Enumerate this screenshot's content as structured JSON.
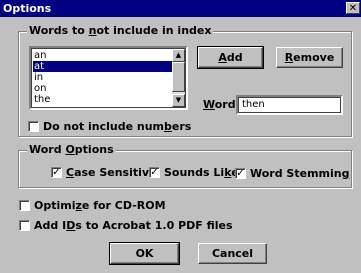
{
  "window": {
    "title": "Options",
    "close_glyph": "✕"
  },
  "index_group": {
    "title_pre": "Words to ",
    "title_accel": "n",
    "title_post": "ot include in index",
    "words": [
      "an",
      "at",
      "in",
      "on",
      "the"
    ],
    "selected_index": 1,
    "add_accel": "A",
    "add_rest": "dd",
    "remove_accel": "R",
    "remove_rest": "emove",
    "word_label_accel": "W",
    "word_label_rest": "ord:",
    "word_value": "then",
    "no_numbers_pre": "Do not include num",
    "no_numbers_accel": "b",
    "no_numbers_post": "ers",
    "no_numbers_checked": false
  },
  "word_options": {
    "title_pre": "Word ",
    "title_accel": "O",
    "title_post": "ptions",
    "case_sensitive": {
      "accel": "C",
      "rest": "ase Sensitive",
      "checked": true
    },
    "sounds_like": {
      "pre": "Sounds Li",
      "accel": "k",
      "post": "e",
      "checked": true
    },
    "word_stemming": {
      "pre": "Word Stemmin",
      "accel": "g",
      "checked": true
    }
  },
  "optimize_cd": {
    "pre": "Optimi",
    "accel": "z",
    "post": "e for CD-ROM",
    "checked": false
  },
  "add_ids": {
    "pre": "Add I",
    "accel": "D",
    "post": "s to Acrobat 1.0 PDF files",
    "checked": false
  },
  "footer": {
    "ok_label": "OK",
    "cancel_label": "Cancel"
  },
  "glyphs": {
    "check": "✓",
    "arrow_up": "▲",
    "arrow_down": "▼"
  }
}
